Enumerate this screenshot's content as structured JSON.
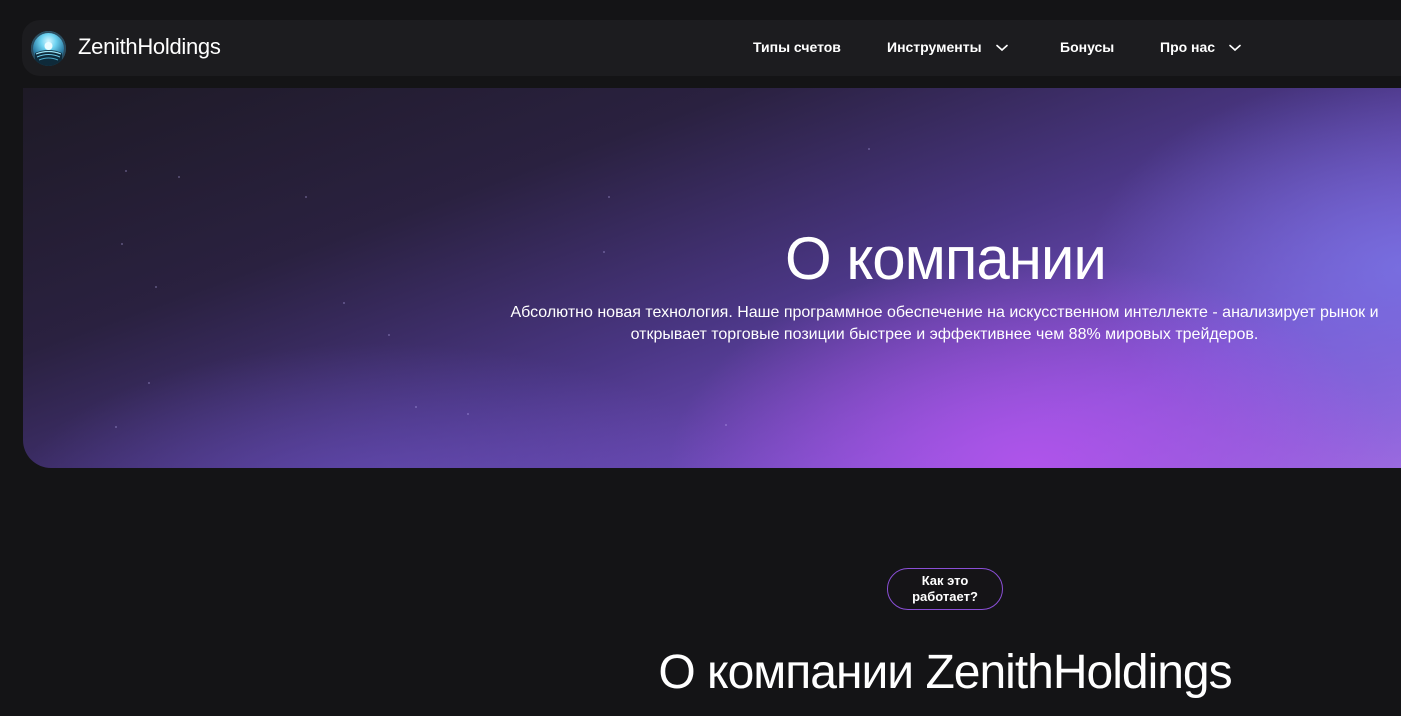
{
  "header": {
    "brand": "ZenithHoldings",
    "logo_icon": "zenith-logo-icon",
    "nav": [
      {
        "label": "Типы счетов",
        "has_dropdown": false
      },
      {
        "label": "Инструменты",
        "has_dropdown": true
      },
      {
        "label": "Бонусы",
        "has_dropdown": false
      },
      {
        "label": "Про нас",
        "has_dropdown": true
      }
    ]
  },
  "hero": {
    "title": "О компании",
    "text": "Абсолютно новая технология. Наше программное обеспечение на искусственном интеллекте - анализирует рынок и открывает торговые позиции быстрее и эффективнее чем 88% мировых трейдеров."
  },
  "how_it_works": {
    "pill_label": "Как это работает?",
    "title": "О компании ZenithHoldings"
  },
  "colors": {
    "page_bg": "#141416",
    "nav_bg": "#1c1c1f",
    "accent": "#8a4fd6",
    "hero_gradient_end": "#b254ec"
  }
}
